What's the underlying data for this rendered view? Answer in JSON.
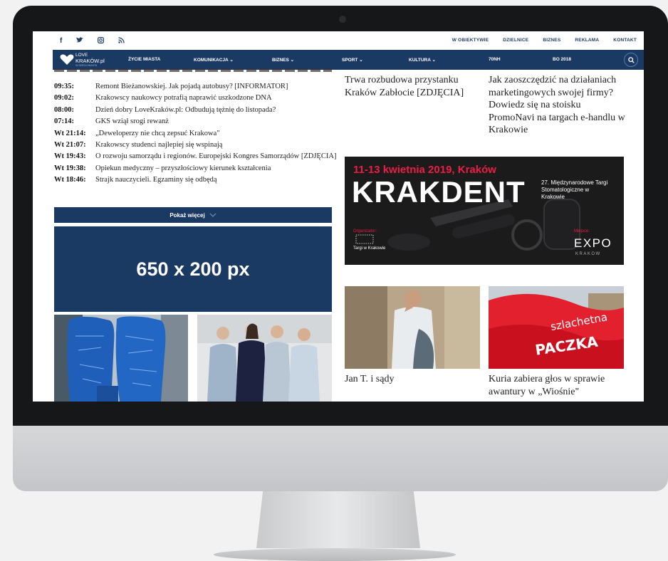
{
  "social": {
    "facebook": "f",
    "twitter": "t",
    "instagram": "ig",
    "rss": "rss"
  },
  "top_links": [
    "W OBIEKTYWIE",
    "DZIELNICE",
    "BIZNES",
    "REKLAMA",
    "KONTAKT"
  ],
  "logo": {
    "line1": "LOVE",
    "line2": "KRAKÓW.pl",
    "line3": "W SERCU MIASTA"
  },
  "nav": [
    {
      "label": "ŻYCIE MIASTA"
    },
    {
      "label": "KOMUNIKACJA ⌄"
    },
    {
      "label": "BIZNES ⌄"
    },
    {
      "label": "SPORT ⌄"
    },
    {
      "label": "KULTURA ⌄"
    },
    {
      "label": "70NH"
    },
    {
      "label": "BO 2018"
    }
  ],
  "news": [
    {
      "time": "09:35:",
      "title": "Remont Bieżanowskiej. Jak pojadą autobusy? [INFORMATOR]"
    },
    {
      "time": "09:02:",
      "title": "Krakowscy naukowcy potrafią naprawić uszkodzone DNA"
    },
    {
      "time": "08:00:",
      "title": "Dzień dobry LoveKraków.pl: Odbudują tężnię do listopada?"
    },
    {
      "time": "07:14:",
      "title": "GKS wziął srogi rewanż"
    },
    {
      "time": "Wt 21:14:",
      "title": "„Deweloperzy nie chcą zepsuć Krakowa\""
    },
    {
      "time": "Wt 21:07:",
      "title": "Krakowscy studenci najlepiej się wspinają"
    },
    {
      "time": "Wt 19:43:",
      "title": "O rozwoju samorządu i regionów. Europejski Kongres Samorządów [ZDJĘCIA]"
    },
    {
      "time": "Wt 19:38:",
      "title": "Opiekun medyczny – przyszłościowy kierunek kształcenia"
    },
    {
      "time": "Wt 18:46:",
      "title": "Strajk nauczycieli. Egzaminy się odbędą"
    }
  ],
  "more_label": "Pokaż więcej",
  "ad_label": "650 x 200 px",
  "right": {
    "article1": "Trwa rozbudowa przystanku Kraków Zabłocie [ZDJĘCIA]",
    "article2": "Jak zaoszczędzić na działaniach marketingowych swojej firmy? Dowiedz się na stoisku PromoNavi na targach e-handlu w Krakowie"
  },
  "krakdent": {
    "date": "11-13 kwietnia 2019, Kraków",
    "name": "KRAKDENT",
    "desc": "27. Międzynarodowe Targi Stomatologiczne w Krakowie",
    "organizer_label": "Organizator:",
    "organizer": "Targi w Krakowie",
    "place_label": "Miejsce:",
    "expo": "EXPO",
    "krakow": "KRAKOW"
  },
  "captions": {
    "man": "Jan T. i sądy",
    "flag": "Kuria zabiera głos w sprawie awantury w „Wiośnie\""
  },
  "flag_text": "szlachetna PACZKA"
}
